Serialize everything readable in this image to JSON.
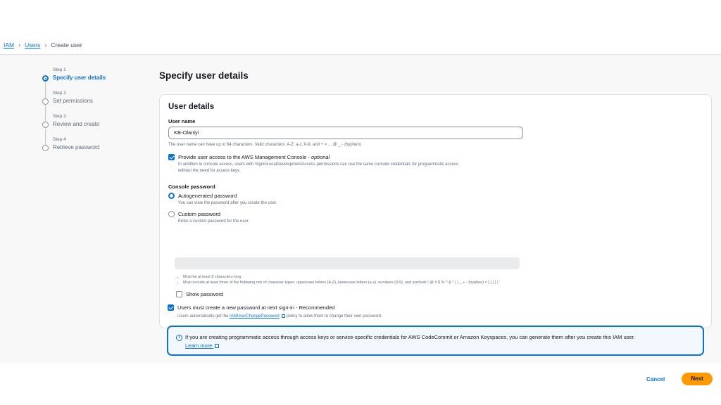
{
  "breadcrumb": {
    "root": "IAM",
    "parent": "Users",
    "current": "Create user"
  },
  "steps": [
    {
      "num": "Step 1",
      "title": "Specify user details",
      "active": true
    },
    {
      "num": "Step 2",
      "title": "Set permissions",
      "active": false
    },
    {
      "num": "Step 3",
      "title": "Review and create",
      "active": false
    },
    {
      "num": "Step 4",
      "title": "Retrieve password",
      "active": false
    }
  ],
  "page_title": "Specify user details",
  "card": {
    "title": "User details",
    "user_name_label": "User name",
    "user_name_value": "KB-Olaniyi",
    "user_name_hint": "The user name can have up to 64 characters. Valid characters: A-Z, a-z, 0-9, and + = , . @ _ - (hyphen)",
    "console_access": {
      "label": "Provide user access to the AWS Management Console -",
      "label_suffix": "optional",
      "checked": true,
      "desc_line1": "In addition to console access, users with SigninLocalDevelopmentAccess permissions can use the same console credentials for programmatic access",
      "desc_line2": "without the need for access keys."
    },
    "console_password_label": "Console password",
    "autogen": {
      "label": "Autogenerated password",
      "desc": "You can view the password after you create the user.",
      "selected": true
    },
    "custom": {
      "label": "Custom password",
      "desc": "Enter a custom password for the user.",
      "selected": false,
      "placeholder": ""
    },
    "rules": [
      "Must be at least 8 characters long",
      "Must include at least three of the following mix of character types: uppercase letters (A-Z), lowercase letters (a-z), numbers (0-9), and symbols ! @ # $ % ^ & * ( ) _ + - (hyphen) = [ ] { } | '"
    ],
    "show_password": {
      "label": "Show password",
      "checked": false
    },
    "must_reset": {
      "label": "Users must create a new password at next sign-in - Recommended",
      "checked": true,
      "desc_prefix": "Users automatically get the",
      "desc_link": "IAMUserChangePassword",
      "desc_suffix": "policy to allow them to change their own password."
    },
    "info": {
      "text": "If you are creating programmatic access through access keys or service-specific credentials for AWS CodeCommit or Amazon Keyspaces, you can generate them after you create this IAM user.",
      "link": "Learn more"
    }
  },
  "actions": {
    "cancel": "Cancel",
    "next": "Next"
  },
  "colors": {
    "accent": "#0972d3",
    "primary_button": "#ff9900"
  }
}
